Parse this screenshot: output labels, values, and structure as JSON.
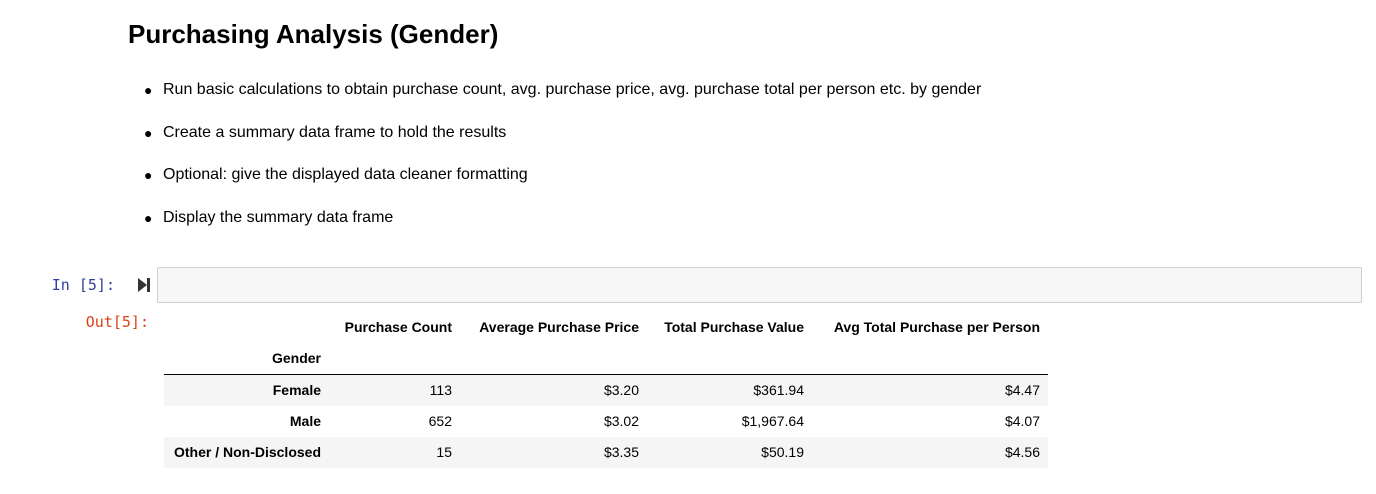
{
  "markdown": {
    "title": "Purchasing Analysis (Gender)",
    "bullets": [
      "Run basic calculations to obtain purchase count, avg. purchase price, avg. purchase total per person etc. by gender",
      "Create a summary data frame to hold the results",
      "Optional: give the displayed data cleaner formatting",
      "Display the summary data frame"
    ]
  },
  "cell": {
    "in_prompt": "In [5]:",
    "out_prompt": "Out[5]:",
    "input_code": ""
  },
  "dataframe": {
    "columns": [
      "Purchase Count",
      "Average Purchase Price",
      "Total Purchase Value",
      "Avg Total Purchase per Person"
    ],
    "index_name": "Gender",
    "rows": [
      {
        "index": "Female",
        "values": [
          "113",
          "$3.20",
          "$361.94",
          "$4.47"
        ]
      },
      {
        "index": "Male",
        "values": [
          "652",
          "$3.02",
          "$1,967.64",
          "$4.07"
        ]
      },
      {
        "index": "Other / Non-Disclosed",
        "values": [
          "15",
          "$3.35",
          "$50.19",
          "$4.56"
        ]
      }
    ]
  },
  "colors": {
    "in_prompt": "#303f9f",
    "out_prompt": "#d84315",
    "input_bg": "#f7f7f7",
    "input_border": "#cfcfcf",
    "row_stripe": "#f5f5f5"
  },
  "icons": {
    "run": "step-forward-icon",
    "bullet": "bullet-dot-icon"
  }
}
